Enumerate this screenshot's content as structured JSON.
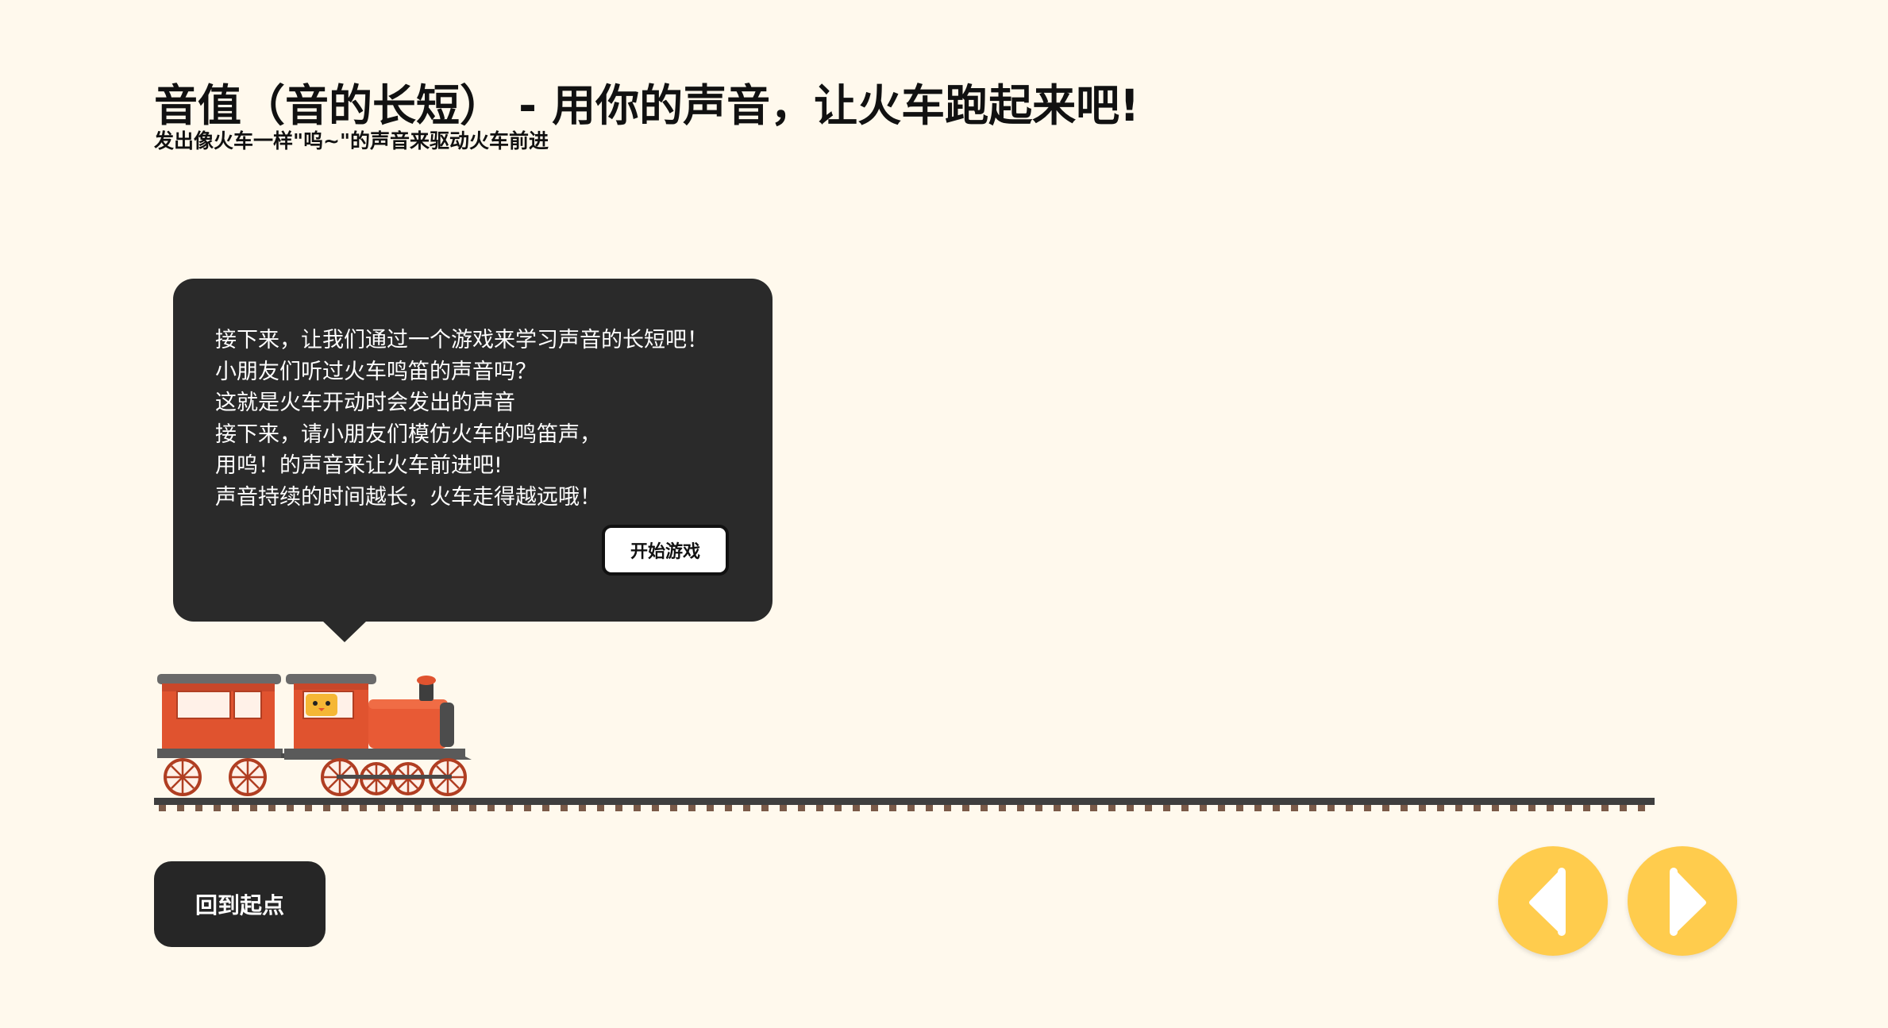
{
  "header": {
    "title": "音值（音的长短） - 用你的声音，让火车跑起来吧!",
    "subtitle": "发出像火车一样\"呜~\"的声音来驱动火车前进"
  },
  "dialog": {
    "lines": [
      "接下来，让我们通过一个游戏来学习声音的长短吧！",
      "小朋友们听过火车鸣笛的声音吗？",
      "这就是火车开动时会发出的声音",
      "接下来，请小朋友们模仿火车的鸣笛声，",
      "用呜！的声音来让火车前进吧!",
      "声音持续的时间越长，火车走得越远哦！"
    ],
    "start_label": "开始游戏"
  },
  "controls": {
    "reset_label": "回到起点",
    "prev_icon": "chevron-left-icon",
    "next_icon": "chevron-right-icon"
  },
  "game": {
    "train_progress": 0,
    "character_icon": "chick-face-icon"
  },
  "colors": {
    "background": "#FFF9ED",
    "bubble": "#2A2A2A",
    "train_body": "#E0532F",
    "accent_yellow": "#FFCC4D",
    "dark_button": "#262626"
  }
}
